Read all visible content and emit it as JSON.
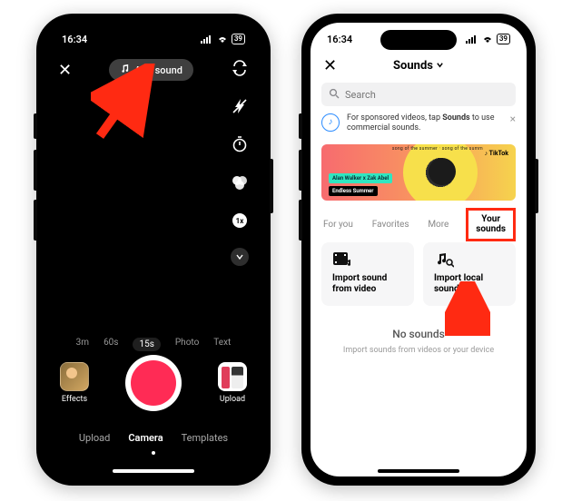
{
  "status": {
    "time": "16:34",
    "battery": "39"
  },
  "left": {
    "add_sound": "Add sound",
    "durations": {
      "d0": "3m",
      "d1": "60s",
      "d2": "15s",
      "d3": "Photo",
      "d4": "Text"
    },
    "effects_label": "Effects",
    "upload_label": "Upload",
    "modes": {
      "m0": "Upload",
      "m1": "Camera",
      "m2": "Templates"
    }
  },
  "right": {
    "title": "Sounds",
    "search_placeholder": "Search",
    "sponsor_text_a": "For sponsored videos, tap ",
    "sponsor_text_b": "Sounds",
    "sponsor_text_c": " to use commercial sounds.",
    "promo": {
      "tag1": "Alan Walker x Zak Abel",
      "tag2": "Endless Summer",
      "brand": "TikTok",
      "ring": "song of the summer · song of the summ"
    },
    "tabs": {
      "t0": "For you",
      "t1": "Favorites",
      "t2": "More",
      "t3a": "Your",
      "t3b": "sounds"
    },
    "import_video": "Import sound from video",
    "import_local": "Import local sound",
    "empty_title": "No sounds",
    "empty_sub": "Import sounds from videos or your device"
  }
}
